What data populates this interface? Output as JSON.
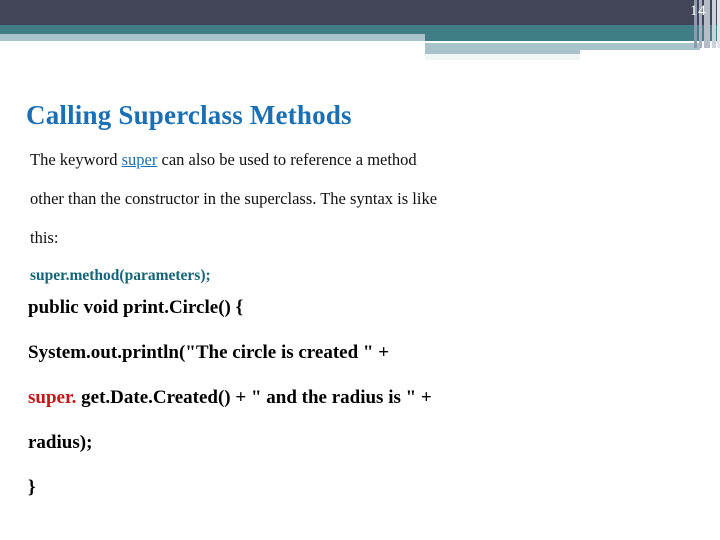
{
  "slide": {
    "page_number": "14",
    "title": "Calling Superclass Methods",
    "body": {
      "line1_pre": "The keyword ",
      "line1_keyword": "super",
      "line1_post": " can also be used to reference a method",
      "line2": "other than the constructor in the superclass. The syntax is like",
      "line3": "this:",
      "syntax_code": "super.method(parameters);"
    },
    "code_block": {
      "line1": "public void print.Circle() {",
      "line2": "System.out.println(\"The circle is created \" +",
      "line3_keyword": "super.",
      "line3_rest": " get.Date.Created() + \" and the radius is \" +",
      "line4": "radius);",
      "line5": "}"
    },
    "colors": {
      "header_navy": "#424457",
      "header_teal": "#417d85",
      "header_light": "#a8c3c9",
      "title_blue": "#1b6fb5",
      "code_teal": "#14657a",
      "keyword_red": "#c41616",
      "body_text": "#101010"
    }
  }
}
